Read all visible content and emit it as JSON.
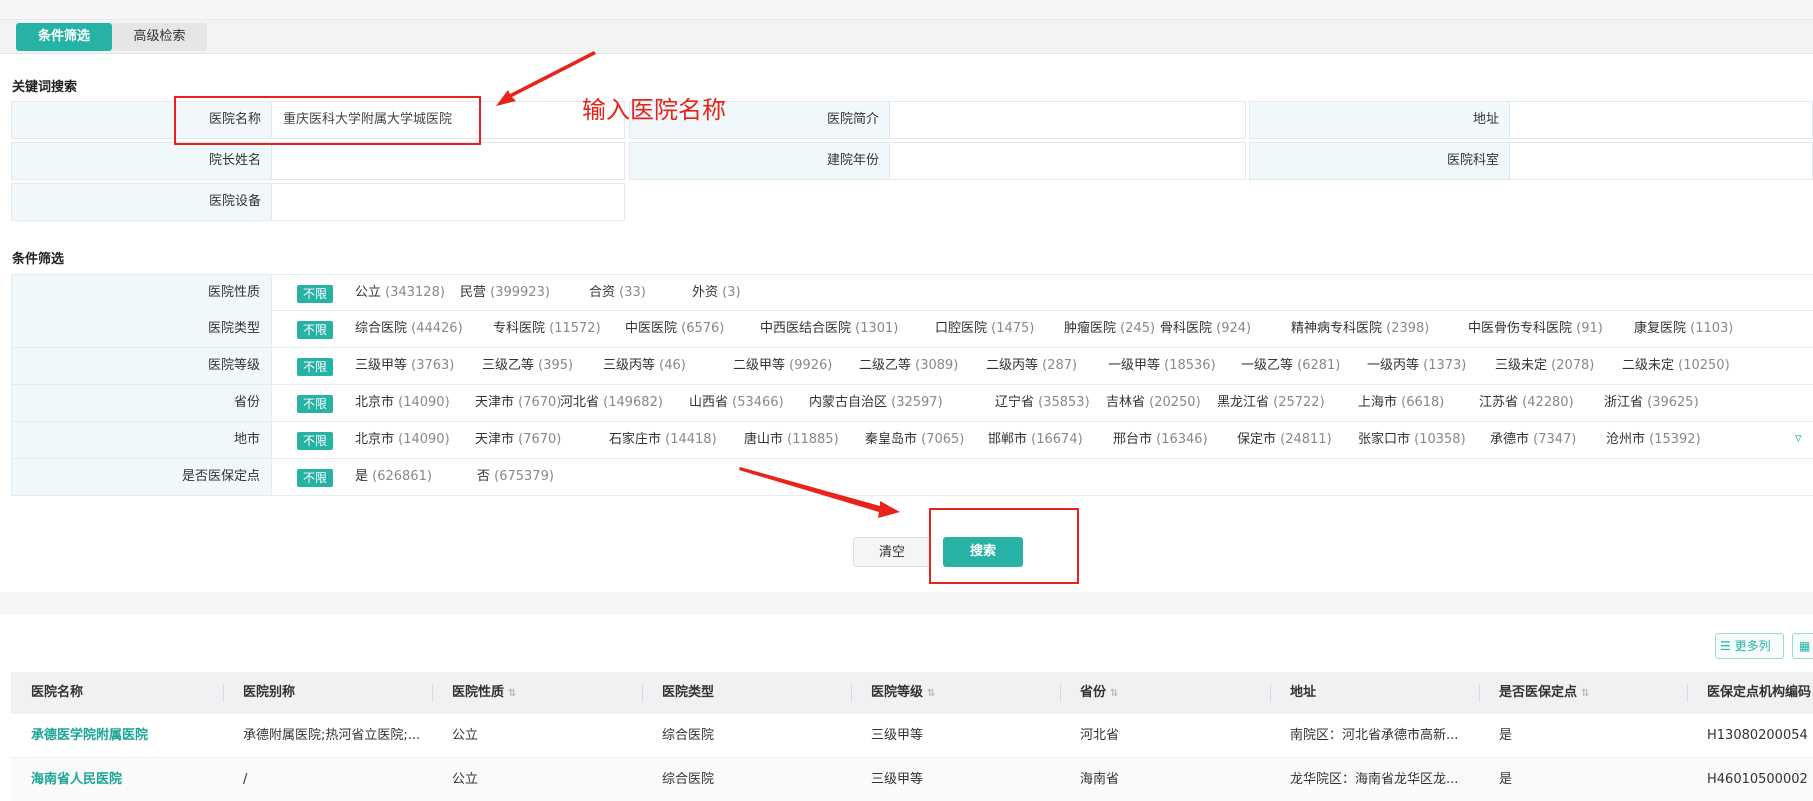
{
  "tabs": [
    {
      "label": "条件筛选",
      "active": true
    },
    {
      "label": "高级检索",
      "active": false
    }
  ],
  "keyword_section": {
    "title": "关键词搜索",
    "fields": [
      {
        "label": "医院名称",
        "value": "重庆医科大学附属大学城医院"
      },
      {
        "label": "医院简介",
        "value": ""
      },
      {
        "label": "地址",
        "value": ""
      },
      {
        "label": "院长姓名",
        "value": ""
      },
      {
        "label": "建院年份",
        "value": ""
      },
      {
        "label": "医院科室",
        "value": ""
      },
      {
        "label": "医院设备",
        "value": ""
      }
    ]
  },
  "annotation": {
    "text": "输入医院名称",
    "color": "#e8231a"
  },
  "filter_section": {
    "title": "条件筛选",
    "unlimited": "不限",
    "rows": [
      {
        "label": "医院性质",
        "options": [
          {
            "name": "公立",
            "count": "(343128)"
          },
          {
            "name": "民营",
            "count": "(399923)"
          },
          {
            "name": "合资",
            "count": "(33)"
          },
          {
            "name": "外资",
            "count": "(3)"
          }
        ]
      },
      {
        "label": "医院类型",
        "options": [
          {
            "name": "综合医院",
            "count": "(44426)"
          },
          {
            "name": "专科医院",
            "count": "(11572)"
          },
          {
            "name": "中医医院",
            "count": "(6576)"
          },
          {
            "name": "中西医结合医院",
            "count": "(1301)"
          },
          {
            "name": "口腔医院",
            "count": "(1475)"
          },
          {
            "name": "肿瘤医院",
            "count": "(245)"
          },
          {
            "name": "骨科医院",
            "count": "(924)"
          },
          {
            "name": "精神病专科医院",
            "count": "(2398)"
          },
          {
            "name": "中医骨伤专科医院",
            "count": "(91)"
          },
          {
            "name": "康复医院",
            "count": "(1103)"
          }
        ]
      },
      {
        "label": "医院等级",
        "options": [
          {
            "name": "三级甲等",
            "count": "(3763)"
          },
          {
            "name": "三级乙等",
            "count": "(395)"
          },
          {
            "name": "三级丙等",
            "count": "(46)"
          },
          {
            "name": "二级甲等",
            "count": "(9926)"
          },
          {
            "name": "二级乙等",
            "count": "(3089)"
          },
          {
            "name": "二级丙等",
            "count": "(287)"
          },
          {
            "name": "一级甲等",
            "count": "(18536)"
          },
          {
            "name": "一级乙等",
            "count": "(6281)"
          },
          {
            "name": "一级丙等",
            "count": "(1373)"
          },
          {
            "name": "三级未定",
            "count": "(2078)"
          },
          {
            "name": "二级未定",
            "count": "(10250)"
          }
        ]
      },
      {
        "label": "省份",
        "options": [
          {
            "name": "北京市",
            "count": "(14090)"
          },
          {
            "name": "天津市",
            "count": "(7670)"
          },
          {
            "name": "河北省",
            "count": "(149682)"
          },
          {
            "name": "山西省",
            "count": "(53466)"
          },
          {
            "name": "内蒙古自治区",
            "count": "(32597)"
          },
          {
            "name": "辽宁省",
            "count": "(35853)"
          },
          {
            "name": "吉林省",
            "count": "(20250)"
          },
          {
            "name": "黑龙江省",
            "count": "(25722)"
          },
          {
            "name": "上海市",
            "count": "(6618)"
          },
          {
            "name": "江苏省",
            "count": "(42280)"
          },
          {
            "name": "浙江省",
            "count": "(39625)"
          }
        ]
      },
      {
        "label": "地市",
        "options": [
          {
            "name": "北京市",
            "count": "(14090)"
          },
          {
            "name": "天津市",
            "count": "(7670)"
          },
          {
            "name": "石家庄市",
            "count": "(14418)"
          },
          {
            "name": "唐山市",
            "count": "(11885)"
          },
          {
            "name": "秦皇岛市",
            "count": "(7065)"
          },
          {
            "name": "邯郸市",
            "count": "(16674)"
          },
          {
            "name": "邢台市",
            "count": "(16346)"
          },
          {
            "name": "保定市",
            "count": "(24811)"
          },
          {
            "name": "张家口市",
            "count": "(10358)"
          },
          {
            "name": "承德市",
            "count": "(7347)"
          },
          {
            "name": "沧州市",
            "count": "(15392)"
          }
        ]
      },
      {
        "label": "是否医保定点",
        "options": [
          {
            "name": "是",
            "count": "(626861)"
          },
          {
            "name": "否",
            "count": "(675379)"
          }
        ]
      }
    ]
  },
  "buttons": {
    "clear": "清空",
    "search": "搜索"
  },
  "table_tools": {
    "more_columns": "更多列"
  },
  "table": {
    "columns": [
      "医院名称",
      "医院别称",
      "医院性质",
      "医院类型",
      "医院等级",
      "省份",
      "地址",
      "是否医保定点",
      "医保定点机构编码"
    ],
    "rows": [
      [
        "承德医学院附属医院",
        "承德附属医院;热河省立医院;...",
        "公立",
        "综合医院",
        "三级甲等",
        "河北省",
        "南院区：河北省承德市高新...",
        "是",
        "H13080200054"
      ],
      [
        "海南省人民医院",
        "/",
        "公立",
        "综合医院",
        "三级甲等",
        "海南省",
        "龙华院区：海南省龙华区龙...",
        "是",
        "H46010500002"
      ]
    ]
  }
}
